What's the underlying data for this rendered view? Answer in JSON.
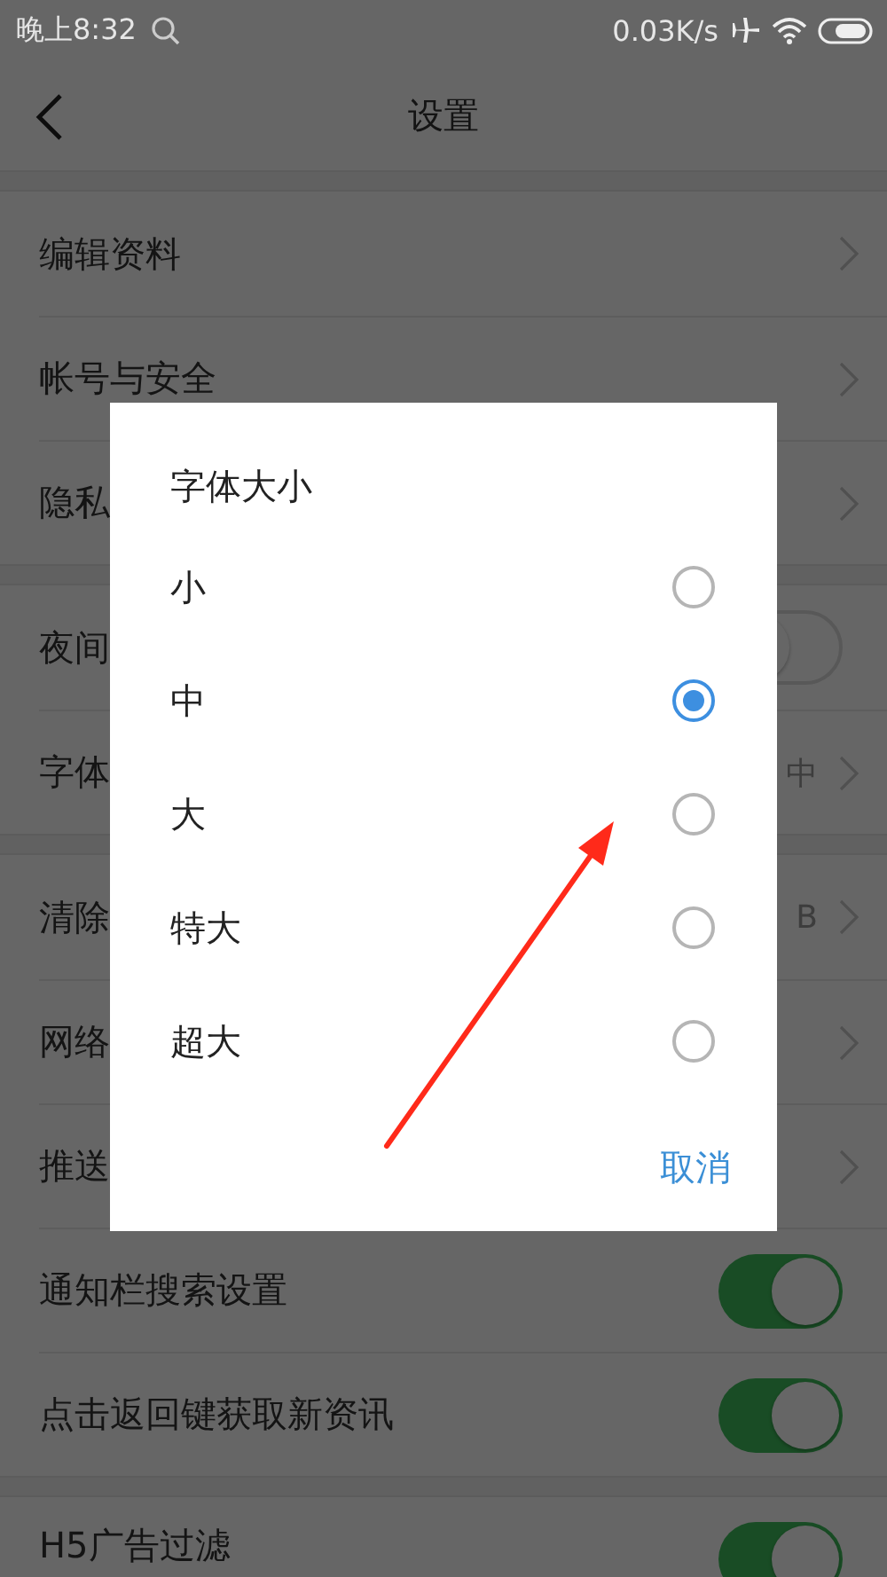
{
  "status_bar": {
    "time": "晚上8:32",
    "speed": "0.03K/s"
  },
  "header": {
    "title": "设置"
  },
  "groups": [
    {
      "rows": [
        {
          "kind": "link",
          "label": "编辑资料"
        },
        {
          "kind": "link",
          "label": "帐号与安全"
        },
        {
          "kind": "link",
          "label": "隐私"
        }
      ]
    },
    {
      "rows": [
        {
          "kind": "toggle",
          "label": "夜间",
          "on": false
        },
        {
          "kind": "link",
          "label": "字体",
          "value": "中"
        }
      ]
    },
    {
      "rows": [
        {
          "kind": "link",
          "label": "清除",
          "value": "B"
        },
        {
          "kind": "link",
          "label": "网络"
        },
        {
          "kind": "link",
          "label": "推送"
        },
        {
          "kind": "toggle",
          "label": "通知栏搜索设置",
          "on": true
        },
        {
          "kind": "toggle",
          "label": "点击返回键获取新资讯",
          "on": true
        }
      ]
    },
    {
      "rows": [
        {
          "kind": "toggle",
          "label": "H5广告过滤",
          "on": true
        }
      ]
    }
  ],
  "dialog": {
    "title": "字体大小",
    "options": [
      {
        "label": "小",
        "selected": false
      },
      {
        "label": "中",
        "selected": true
      },
      {
        "label": "大",
        "selected": false
      },
      {
        "label": "特大",
        "selected": false
      },
      {
        "label": "超大",
        "selected": false
      }
    ],
    "cancel": "取消"
  }
}
